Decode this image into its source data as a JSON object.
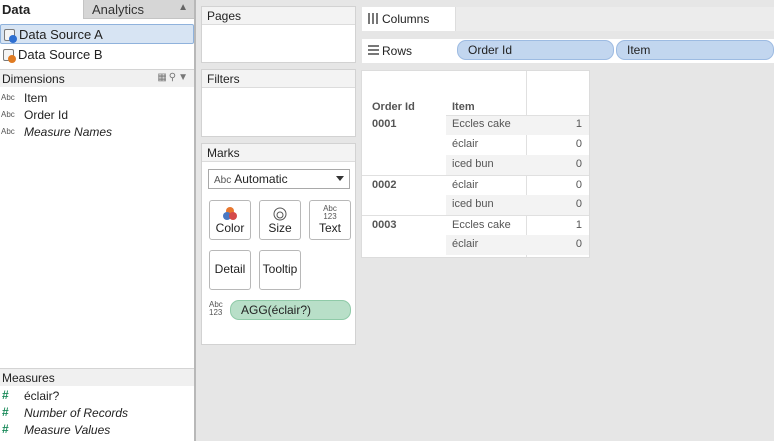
{
  "tabs": {
    "data": "Data",
    "analytics": "Analytics"
  },
  "data_sources": [
    {
      "label": "Data Source A",
      "selected": true,
      "badge_color": "#2e6fd1"
    },
    {
      "label": "Data Source B",
      "selected": false,
      "badge_color": "#e07b22"
    }
  ],
  "dimensions": {
    "title": "Dimensions",
    "fields": [
      {
        "type": "Abc",
        "name": "Item"
      },
      {
        "type": "Abc",
        "name": "Order Id"
      },
      {
        "type": "Abc",
        "name": "Measure Names"
      }
    ]
  },
  "measures": {
    "title": "Measures",
    "fields": [
      {
        "type": "#",
        "name": "éclair?"
      },
      {
        "type": "#",
        "name": "Number of Records"
      },
      {
        "type": "#",
        "name": "Measure Values"
      }
    ]
  },
  "cards": {
    "pages": "Pages",
    "filters": "Filters",
    "marks": "Marks"
  },
  "marks": {
    "type_prefix": "Abc",
    "type": "Automatic",
    "buttons": {
      "color": "Color",
      "size": "Size",
      "text": "Text",
      "detail": "Detail",
      "tooltip": "Tooltip"
    },
    "text_icon_line1": "Abc",
    "text_icon_line2": "123",
    "pill": "AGG(éclair?)"
  },
  "shelves": {
    "columns": "Columns",
    "rows": "Rows",
    "row_pills": [
      "Order Id",
      "Item"
    ]
  },
  "table": {
    "headers": {
      "order_id": "Order Id",
      "item": "Item"
    },
    "rows": [
      {
        "order_id": "0001",
        "item": "Eccles cake",
        "value": "1"
      },
      {
        "order_id": "",
        "item": "éclair",
        "value": "0"
      },
      {
        "order_id": "",
        "item": "iced bun",
        "value": "0"
      },
      {
        "order_id": "0002",
        "item": "éclair",
        "value": "0"
      },
      {
        "order_id": "",
        "item": "iced bun",
        "value": "0"
      },
      {
        "order_id": "0003",
        "item": "Eccles cake",
        "value": "1"
      },
      {
        "order_id": "",
        "item": "éclair",
        "value": "0"
      }
    ]
  },
  "colors": {
    "pill_blue": "#c2d6ef",
    "pill_green": "#b8dfc8",
    "selection": "#d7e4f3"
  }
}
